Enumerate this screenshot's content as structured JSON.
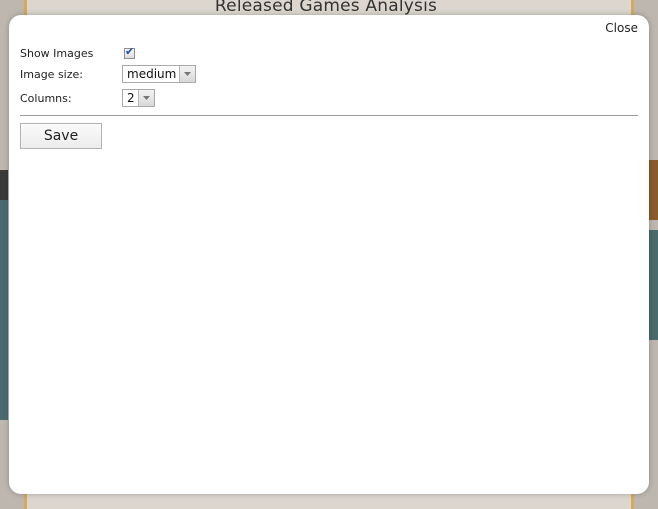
{
  "background": {
    "title": "Released Games Analysis"
  },
  "dialog": {
    "close_label": "Close",
    "show_images": {
      "label": "Show Images",
      "checked": true
    },
    "image_size": {
      "label": "Image size:",
      "value": "medium"
    },
    "columns": {
      "label": "Columns:",
      "value": "2"
    },
    "save_label": "Save"
  },
  "icons": {
    "checkbox_check": "checkmark-icon",
    "dropdown_arrow": "chevron-down-icon"
  },
  "colors": {
    "checkmark": "#1e4fa0",
    "backdrop_accent": "#d9a85a"
  }
}
